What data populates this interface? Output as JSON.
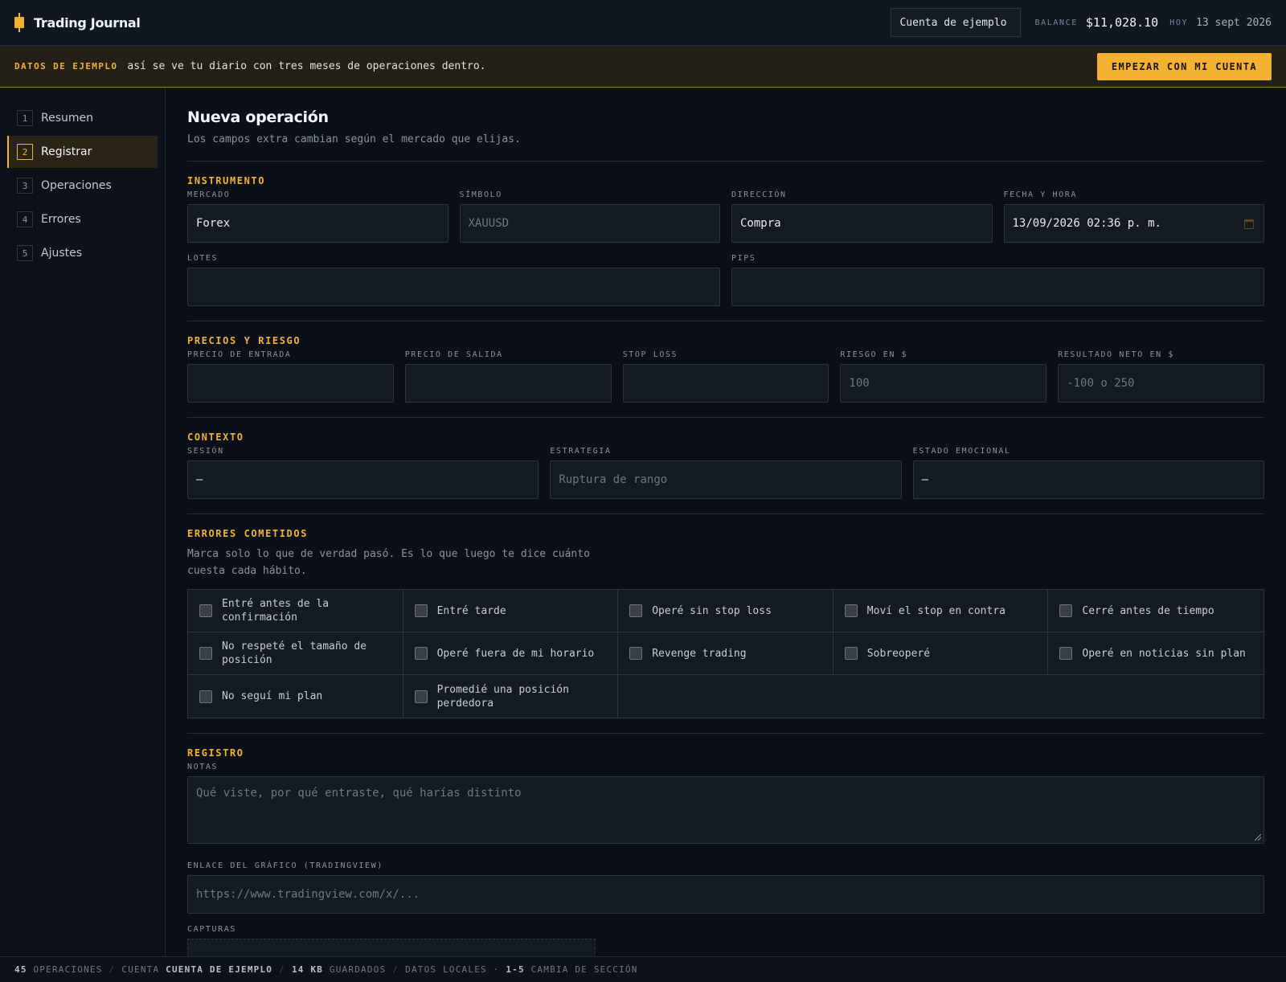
{
  "app": {
    "title": "Trading Journal"
  },
  "header": {
    "account": "Cuenta de ejemplo",
    "balance_label": "BALANCE",
    "balance_value": "$11,028.10",
    "today_label": "HOY",
    "today_value": "13 sept 2026"
  },
  "banner": {
    "tag": "DATOS DE EJEMPLO",
    "text": "así se ve tu diario con tres meses de operaciones dentro.",
    "button": "EMPEZAR CON MI CUENTA"
  },
  "sidebar": {
    "items": [
      {
        "num": "1",
        "label": "Resumen",
        "active": false
      },
      {
        "num": "2",
        "label": "Registrar",
        "active": true
      },
      {
        "num": "3",
        "label": "Operaciones",
        "active": false
      },
      {
        "num": "4",
        "label": "Errores",
        "active": false
      },
      {
        "num": "5",
        "label": "Ajustes",
        "active": false
      }
    ]
  },
  "page": {
    "title": "Nueva operación",
    "subtitle": "Los campos extra cambian según el mercado que elijas."
  },
  "instrument": {
    "title": "INSTRUMENTO",
    "market_label": "MERCADO",
    "market_value": "Forex",
    "symbol_label": "SÍMBOLO",
    "symbol_placeholder": "XAUUSD",
    "direction_label": "DIRECCIÓN",
    "direction_value": "Compra",
    "datetime_label": "FECHA Y HORA",
    "datetime_value": "13/09/2026 02:36 p. m.",
    "lots_label": "LOTES",
    "lots_value": "",
    "pips_label": "PIPS",
    "pips_value": ""
  },
  "prices": {
    "title": "PRECIOS Y RIESGO",
    "entry_label": "PRECIO DE ENTRADA",
    "entry_value": "",
    "exit_label": "PRECIO DE SALIDA",
    "exit_value": "",
    "sl_label": "STOP LOSS",
    "sl_value": "",
    "risk_label": "RIESGO EN $",
    "risk_placeholder": "100",
    "result_label": "RESULTADO NETO EN $",
    "result_placeholder": "-100 o 250"
  },
  "context": {
    "title": "CONTEXTO",
    "session_label": "SESIÓN",
    "session_value": "—",
    "strategy_label": "ESTRATEGIA",
    "strategy_placeholder": "Ruptura de rango",
    "emotion_label": "ESTADO EMOCIONAL",
    "emotion_value": "—"
  },
  "errors": {
    "title": "ERRORES COMETIDOS",
    "hint_line1": "Marca solo lo que de verdad pasó. Es lo que luego te dice cuánto",
    "hint_line2": "cuesta cada hábito.",
    "items": [
      "Entré antes de la confirmación",
      "Entré tarde",
      "Operé sin stop loss",
      "Moví el stop en contra",
      "Cerré antes de tiempo",
      "No respeté el tamaño de posición",
      "Operé fuera de mi horario",
      "Revenge trading",
      "Sobreoperé",
      "Operé en noticias sin plan",
      "No seguí mi plan",
      "Promedié una posición perdedora"
    ]
  },
  "record": {
    "title": "REGISTRO",
    "notes_label": "NOTAS",
    "notes_placeholder": "Qué viste, por qué entraste, qué harías distinto",
    "chart_label": "ENLACE DEL GRÁFICO (TRADINGVIEW)",
    "chart_placeholder": "https://www.tradingview.com/x/...",
    "captures_label": "CAPTURAS"
  },
  "status": {
    "ops_count": "45",
    "ops_label": "OPERACIONES",
    "account_label": "CUENTA",
    "account_value": "CUENTA DE EJEMPLO",
    "size_value": "14 KB",
    "size_label": "GUARDADOS",
    "local_label": "DATOS LOCALES ·",
    "keys_value": "1-5",
    "keys_label": "CAMBIA DE SECCIÓN"
  }
}
